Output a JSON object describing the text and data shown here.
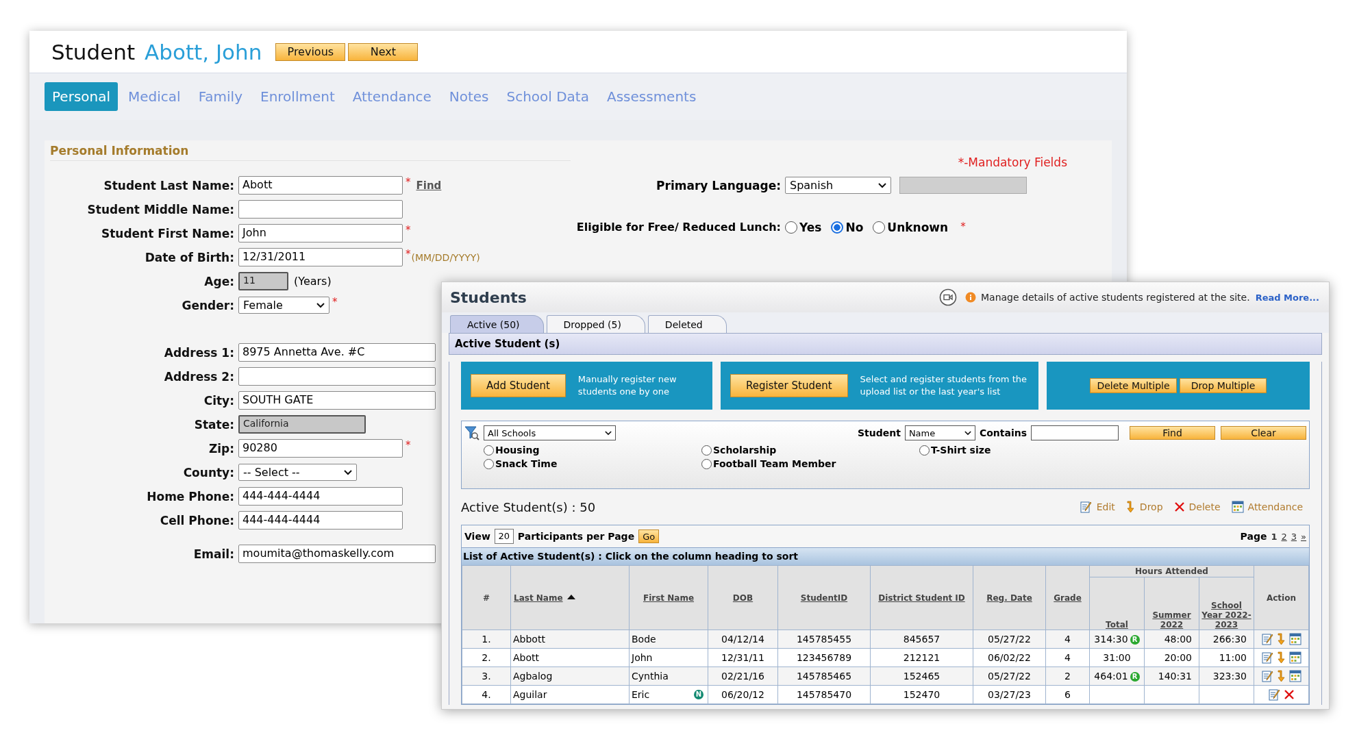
{
  "student_window": {
    "title": "Student",
    "student_name": "Abott, John",
    "buttons": [
      "Previous",
      "Next"
    ],
    "tabs": [
      {
        "label": "Personal",
        "selected": true
      },
      {
        "label": "Medical",
        "selected": false
      },
      {
        "label": "Family",
        "selected": false
      },
      {
        "label": "Enrollment",
        "selected": false
      },
      {
        "label": "Attendance",
        "selected": false
      },
      {
        "label": "Notes",
        "selected": false
      },
      {
        "label": "School Data",
        "selected": false
      },
      {
        "label": "Assessments",
        "selected": false
      }
    ],
    "section_title": "Personal Information",
    "mandatory_note": "*-Mandatory Fields",
    "field_groups": [
      [
        {
          "label": "Student Last Name:",
          "kind": "text",
          "value": "Abott",
          "mark": "*",
          "link": "Find"
        },
        {
          "label": "Student Middle Name:",
          "kind": "text"
        },
        {
          "label": "Student First Name:",
          "kind": "text",
          "value": "John",
          "mark": "*"
        },
        {
          "label": "Date of Birth:",
          "kind": "text",
          "value": "12/31/2011",
          "mark": "*",
          "hint": "(MM/DD/YYYY)"
        },
        {
          "label": "Age:",
          "kind": "readonly",
          "value": "11",
          "suffix": "(Years)"
        },
        {
          "label": "Gender:",
          "kind": "select",
          "value": "Female",
          "mark": "*"
        }
      ],
      [
        {
          "label": "Address 1:",
          "kind": "wide",
          "value": "8975 Annetta Ave. #C"
        },
        {
          "label": "Address 2:",
          "kind": "wide"
        },
        {
          "label": "City:",
          "kind": "wide",
          "value": "SOUTH GATE"
        },
        {
          "label": "State:",
          "kind": "readonly_wide",
          "value": "California"
        },
        {
          "label": "Zip:",
          "kind": "text",
          "value": "90280",
          "mark": "*"
        },
        {
          "label": "County:",
          "kind": "select_wide",
          "value": "-- Select --"
        },
        {
          "label": "Home Phone:",
          "kind": "text",
          "value": "444-444-4444"
        },
        {
          "label": "Cell Phone:",
          "kind": "text",
          "value": "444-444-4444"
        }
      ],
      [
        {
          "label": "Email:",
          "kind": "wide",
          "value": "moumita@thomaskelly.com"
        }
      ]
    ],
    "primary_language": {
      "label": "Primary Language:",
      "value": "Spanish"
    },
    "lunch": {
      "label": "Eligible for Free/ Reduced Lunch:",
      "mark": "*",
      "options": [
        {
          "label": "Yes",
          "selected": false
        },
        {
          "label": "No",
          "selected": true
        },
        {
          "label": "Unknown",
          "selected": false
        }
      ]
    }
  },
  "students_window": {
    "title": "Students",
    "help_text": "Manage details of active students registered at the site.",
    "help_link": "Read More...",
    "tabs": [
      {
        "label": "Active (50)",
        "selected": true
      },
      {
        "label": "Dropped (5)",
        "selected": false
      },
      {
        "label": "Deleted",
        "selected": false
      }
    ],
    "section_bar": "Active Student (s)",
    "action_panels": [
      {
        "buttons": [
          "Add Student"
        ],
        "text": "Manually register new students one by one"
      },
      {
        "buttons": [
          "Register Student"
        ],
        "text": "Select and register students from the upload list or the last year's list"
      },
      {
        "buttons": [
          "Delete Multiple",
          "Drop Multiple"
        ]
      }
    ],
    "filter": {
      "school": "All Schools",
      "student_label": "Student",
      "student_by": "Name",
      "contains_label": "Contains",
      "buttons": [
        "Find",
        "Clear"
      ],
      "options": [
        {
          "label": "Housing",
          "selected": false
        },
        {
          "label": "Scholarship",
          "selected": false
        },
        {
          "label": "T-Shirt size",
          "selected": false
        },
        {
          "label": "Snack Time",
          "selected": false
        },
        {
          "label": "Football Team Member",
          "selected": false
        }
      ]
    },
    "summary": "Active Student(s) : 50",
    "legend": [
      {
        "kind": "edit",
        "label": "Edit"
      },
      {
        "kind": "drop",
        "label": "Drop"
      },
      {
        "kind": "delete",
        "label": "Delete"
      },
      {
        "kind": "attendance",
        "label": "Attendance"
      }
    ],
    "view": {
      "label": "View",
      "value": "20",
      "suffix": "Participants per Page",
      "button": "Go"
    },
    "pager": {
      "label": "Page",
      "pages": [
        {
          "label": "1",
          "selected": true
        },
        {
          "label": "2",
          "selected": false
        },
        {
          "label": "3",
          "selected": false
        }
      ],
      "next": "»"
    },
    "caption": "List of Active Student(s) : Click on the column heading to sort",
    "table": {
      "columns": [
        {
          "label": "#"
        },
        {
          "label": "Last Name",
          "sorted": true
        },
        {
          "label": "First Name"
        },
        {
          "label": "DOB"
        },
        {
          "label": "StudentID"
        },
        {
          "label": "District Student ID"
        },
        {
          "label": "Reg. Date"
        },
        {
          "label": "Grade"
        }
      ],
      "group": {
        "label": "Hours Attended",
        "columns": [
          "Total",
          "Summer 2022",
          "School Year 2022-2023"
        ]
      },
      "action_column": "Action",
      "rows": [
        {
          "num": "1.",
          "last": "Abbott",
          "first": "Bode",
          "dob": "04/12/14",
          "sid": "145785455",
          "dsid": "845657",
          "reg": "05/27/22",
          "grade": "4",
          "total": "314:30",
          "total_badge": "R",
          "summer": "48:00",
          "year": "266:30",
          "actions": [
            {
              "kind": "edit"
            },
            {
              "kind": "drop"
            },
            {
              "kind": "attendance"
            }
          ]
        },
        {
          "num": "2.",
          "last": "Abott",
          "first": "John",
          "dob": "12/31/11",
          "sid": "123456789",
          "dsid": "212121",
          "reg": "06/02/22",
          "grade": "4",
          "total": "31:00",
          "summer": "20:00",
          "year": "11:00",
          "actions": [
            {
              "kind": "edit"
            },
            {
              "kind": "drop"
            },
            {
              "kind": "attendance"
            }
          ]
        },
        {
          "num": "3.",
          "last": "Agbalog",
          "first": "Cynthia",
          "dob": "02/21/16",
          "sid": "145785465",
          "dsid": "152465",
          "reg": "05/27/22",
          "grade": "2",
          "total": "464:01",
          "total_badge": "R",
          "summer": "140:31",
          "year": "323:30",
          "actions": [
            {
              "kind": "edit"
            },
            {
              "kind": "drop"
            },
            {
              "kind": "attendance"
            }
          ]
        },
        {
          "num": "4.",
          "last": "Aguilar",
          "first": "Eric",
          "first_badge": "N",
          "dob": "06/20/12",
          "sid": "145785470",
          "dsid": "152470",
          "reg": "03/27/23",
          "grade": "6",
          "actions": [
            {
              "kind": "edit"
            },
            {
              "kind": "delete"
            }
          ]
        }
      ]
    }
  }
}
